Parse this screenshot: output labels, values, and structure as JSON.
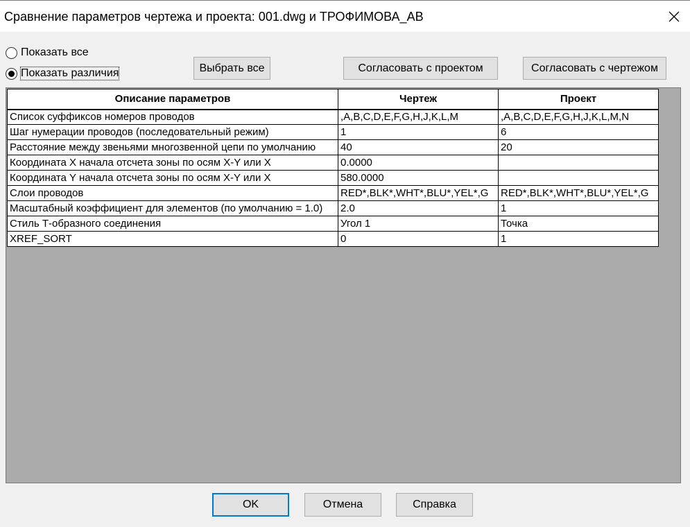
{
  "window": {
    "title": "Сравнение параметров чертежа и проекта: 001.dwg и ТРОФИМОВА_АВ",
    "close_icon": "close-icon"
  },
  "filter": {
    "show_all_label": "Показать все",
    "show_diff_label": "Показать различия",
    "selected": "show_diff"
  },
  "toolbar": {
    "select_all_label": "Выбрать все",
    "match_project_label": "Согласовать с проектом",
    "match_drawing_label": "Согласовать с чертежом"
  },
  "table": {
    "headers": [
      "Описание параметров",
      "Чертеж",
      "Проект"
    ],
    "rows": [
      [
        "Список суффиксов номеров проводов",
        ",A,B,C,D,E,F,G,H,J,K,L,M",
        ",A,B,C,D,E,F,G,H,J,K,L,M,N"
      ],
      [
        "Шаг нумерации проводов (последовательный режим)",
        "1",
        "6"
      ],
      [
        "Расстояние между звеньями многозвенной цепи по умолчанию",
        "40",
        "20"
      ],
      [
        "Координата X начала отсчета зоны по осям X-Y или X",
        "0.0000",
        ""
      ],
      [
        "Координата Y начала отсчета зоны по осям X-Y или X",
        "580.0000",
        ""
      ],
      [
        "Слои проводов",
        "RED*,BLK*,WHT*,BLU*,YEL*,G",
        "RED*,BLK*,WHT*,BLU*,YEL*,G"
      ],
      [
        "Масштабный коэффициент для элементов (по умолчанию = 1.0)",
        "2.0",
        "1"
      ],
      [
        "Стиль Т-образного соединения",
        "Угол 1",
        "Точка"
      ],
      [
        "XREF_SORT",
        "0",
        "1"
      ]
    ]
  },
  "footer": {
    "ok_label": "OK",
    "cancel_label": "Отмена",
    "help_label": "Справка"
  },
  "colors": {
    "dialog_bg": "#f0f0f0",
    "grid_bg": "#ababab",
    "default_button_border": "#0078d7"
  }
}
